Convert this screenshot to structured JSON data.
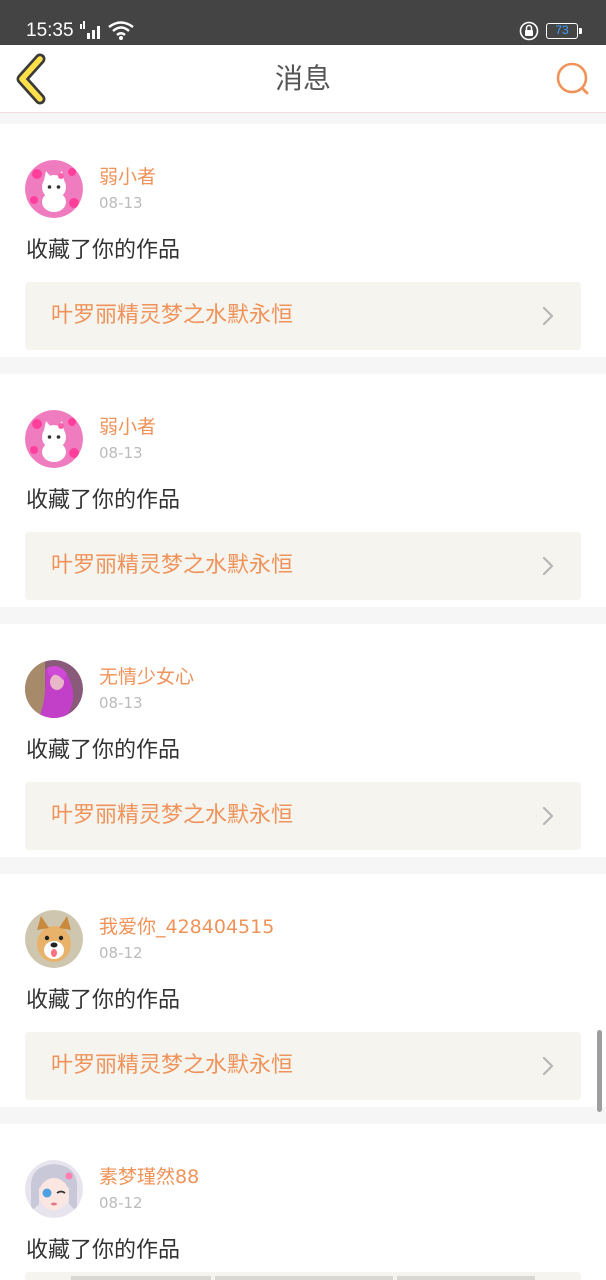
{
  "status_bar": {
    "time": "15:35",
    "battery": "73",
    "icons": [
      "signal-icon",
      "wifi-icon",
      "lock-rotation-icon",
      "battery-icon"
    ]
  },
  "nav": {
    "title": "消息",
    "back_icon": "back-chevron-icon",
    "search_icon": "search-icon"
  },
  "colors": {
    "accent": "#f0935a",
    "link_bg": "#f5f4ef",
    "status_bar_bg": "#444444"
  },
  "messages": [
    {
      "user": "弱小者",
      "date": "08-13",
      "action": "收藏了你的作品",
      "work_title": "叶罗丽精灵梦之水默永恒",
      "avatar": "pink-cat-avatar"
    },
    {
      "user": "弱小者",
      "date": "08-13",
      "action": "收藏了你的作品",
      "work_title": "叶罗丽精灵梦之水默永恒",
      "avatar": "pink-cat-avatar"
    },
    {
      "user": "无情少女心",
      "date": "08-13",
      "action": "收藏了你的作品",
      "work_title": "叶罗丽精灵梦之水默永恒",
      "avatar": "purple-girl-avatar"
    },
    {
      "user": "我爱你_428404515",
      "date": "08-12",
      "action": "收藏了你的作品",
      "work_title": "叶罗丽精灵梦之水默永恒",
      "avatar": "puppy-avatar"
    },
    {
      "user": "素梦瑾然88",
      "date": "08-12",
      "action": "收藏了你的作品",
      "work_title": "",
      "avatar": "anime-girl-avatar"
    }
  ]
}
